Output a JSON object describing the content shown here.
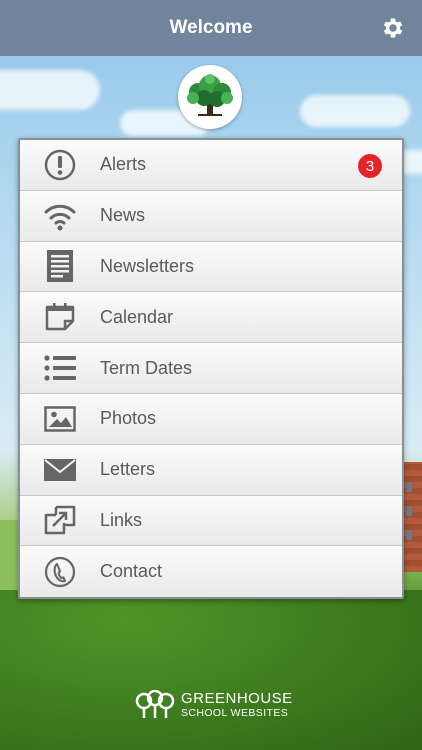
{
  "header": {
    "title": "Welcome",
    "settings_icon": "gear-icon"
  },
  "logo": {
    "icon": "tree-icon"
  },
  "menu": {
    "items": [
      {
        "label": "Alerts",
        "icon": "alert-icon",
        "badge": "3"
      },
      {
        "label": "News",
        "icon": "wifi-icon"
      },
      {
        "label": "Newsletters",
        "icon": "document-icon"
      },
      {
        "label": "Calendar",
        "icon": "calendar-icon"
      },
      {
        "label": "Term Dates",
        "icon": "list-icon"
      },
      {
        "label": "Photos",
        "icon": "photo-icon"
      },
      {
        "label": "Letters",
        "icon": "envelope-icon"
      },
      {
        "label": "Links",
        "icon": "links-icon"
      },
      {
        "label": "Contact",
        "icon": "phone-icon"
      }
    ]
  },
  "footer": {
    "brand_line1": "GREENHOUSE",
    "brand_line2": "SCHOOL WEBSITES",
    "brand_icon": "greenhouse-logo-icon"
  },
  "colors": {
    "topbar": "#6e8096",
    "badge": "#e5242a",
    "icon": "#666666",
    "label": "#5a5a5a"
  }
}
